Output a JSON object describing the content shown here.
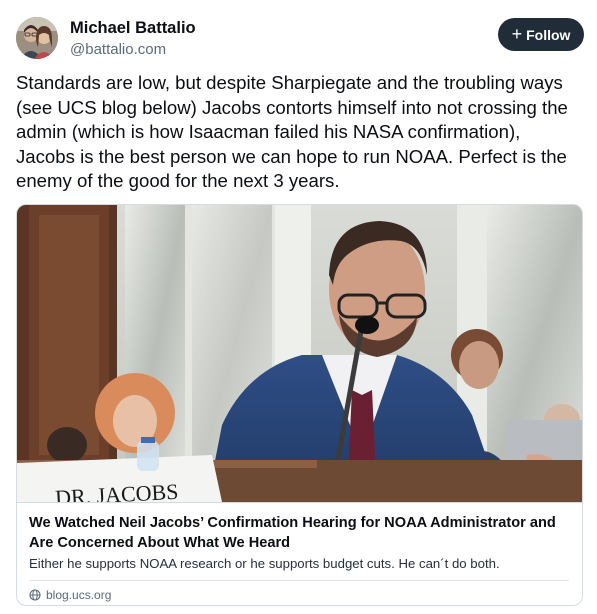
{
  "author": {
    "display_name": "Michael Battalio",
    "handle": "@battalio.com"
  },
  "follow_button": {
    "icon": "plus-icon",
    "label": "Follow"
  },
  "post": {
    "text": "Standards are low, but despite Sharpiegate and the troubling ways (see UCS blog below) Jacobs contorts himself into not crossing the admin (which is how Isaacman failed his NASA confirmation), Jacobs is the best person we can hope to run NOAA. Perfect is the enemy of the good for the next 3 years."
  },
  "link_card": {
    "image_caption_text": "DR. JACOBS",
    "title": "We Watched Neil Jacobs’ Confirmation Hearing for NOAA Administrator and Are Concerned About What We Heard",
    "description": "Either he supports NOAA research or he supports budget cuts. He can´t do both.",
    "domain_icon": "globe-icon",
    "domain": "blog.ucs.org"
  },
  "colors": {
    "follow_bg": "#202c38",
    "handle": "#5b6b7c",
    "border": "#d4dbe2"
  }
}
